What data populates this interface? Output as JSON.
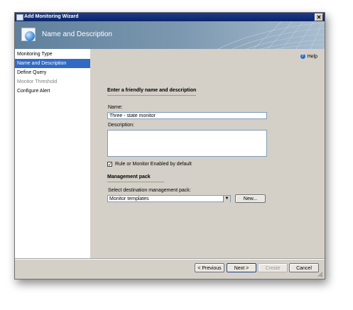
{
  "window": {
    "title": "Add Monitoring Wizard",
    "close_label": "✕"
  },
  "banner": {
    "title": "Name and Description"
  },
  "sidebar": {
    "items": [
      {
        "label": "Monitoring Type",
        "state": "normal"
      },
      {
        "label": "Name and Description",
        "state": "active"
      },
      {
        "label": "Define Query",
        "state": "normal"
      },
      {
        "label": "Monitor Threshold",
        "state": "disabled"
      },
      {
        "label": "Configure Alert",
        "state": "normal"
      }
    ]
  },
  "help": {
    "label": "Help"
  },
  "form": {
    "heading": "Enter a friendly name and description",
    "name_label": "Name:",
    "name_value": "Three - state monitor",
    "description_label": "Description:",
    "description_value": "",
    "enabled_checked": true,
    "enabled_label": "Rule or Monitor Enabled by default"
  },
  "management_pack": {
    "heading": "Management pack",
    "select_label": "Select destination management pack:",
    "selected_value": "Monitor templates",
    "new_button": "New..."
  },
  "footer": {
    "previous": "< Previous",
    "next": "Next >",
    "create": "Create",
    "cancel": "Cancel"
  },
  "colors": {
    "selection": "#316ac5",
    "titlebar": "#0a246a",
    "banner": "#7d99b1"
  }
}
